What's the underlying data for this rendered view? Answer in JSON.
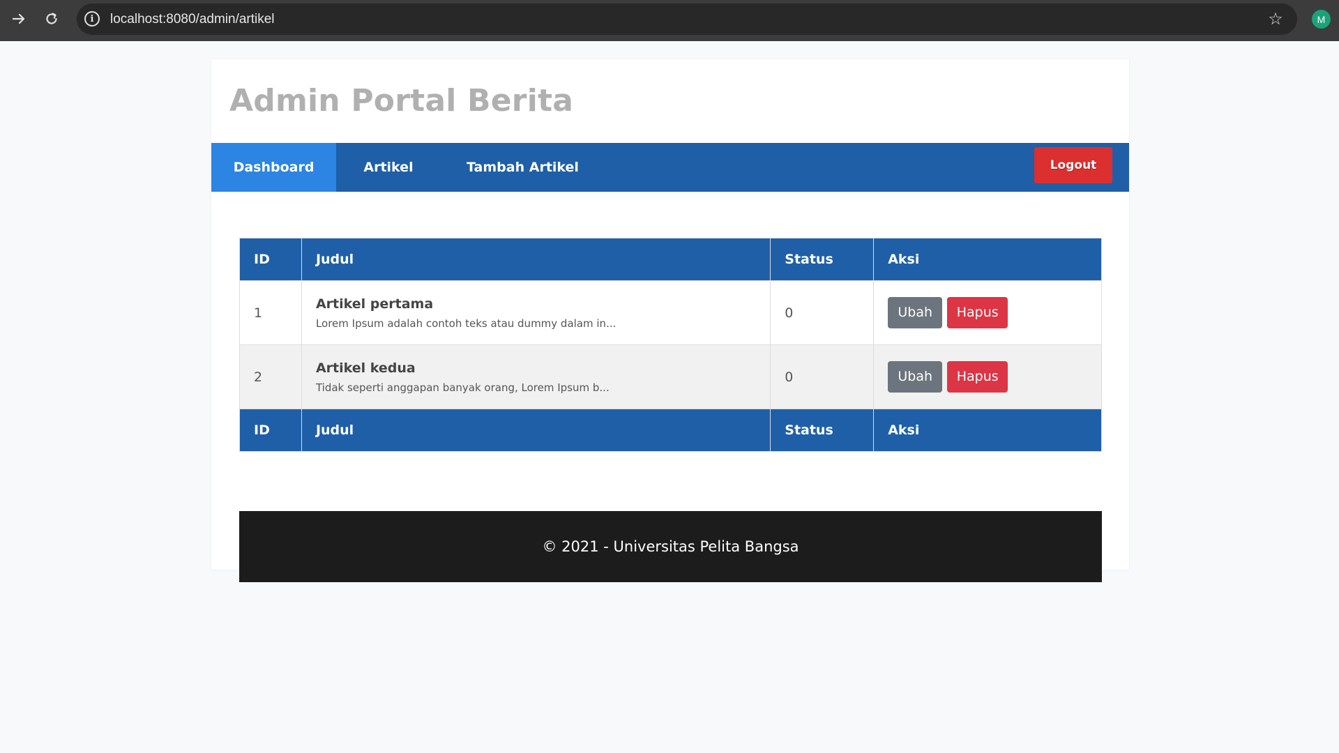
{
  "browser": {
    "url": "localhost:8080/admin/artikel",
    "profile_initial": "M",
    "icons": {
      "forward": "arrow-right-icon",
      "reload": "reload-icon",
      "info": "info-icon",
      "bookmark": "star-icon"
    }
  },
  "site": {
    "title": "Admin Portal Berita"
  },
  "nav": {
    "items": [
      {
        "label": "Dashboard",
        "active": true
      },
      {
        "label": "Artikel",
        "active": false
      },
      {
        "label": "Tambah Artikel",
        "active": false
      }
    ],
    "logout_label": "Logout"
  },
  "table": {
    "headers": [
      "ID",
      "Judul",
      "Status",
      "Aksi"
    ],
    "rows": [
      {
        "id": "1",
        "title": "Artikel pertama",
        "excerpt": "Lorem Ipsum adalah contoh teks atau dummy dalam in...",
        "status": "0",
        "edit_label": "Ubah",
        "delete_label": "Hapus"
      },
      {
        "id": "2",
        "title": "Artikel kedua",
        "excerpt": "Tidak seperti anggapan banyak orang, Lorem Ipsum b...",
        "status": "0",
        "edit_label": "Ubah",
        "delete_label": "Hapus"
      }
    ],
    "footer_headers": [
      "ID",
      "Judul",
      "Status",
      "Aksi"
    ]
  },
  "footer": {
    "text": "© 2021 - Universitas Pelita Bangsa"
  },
  "colors": {
    "navbar": "#1f5fa8",
    "nav_active": "#2c84e3",
    "logout": "#dc2f2f",
    "btn_edit": "#6c757d",
    "btn_delete": "#dc3545",
    "footer": "#1c1c1c"
  }
}
